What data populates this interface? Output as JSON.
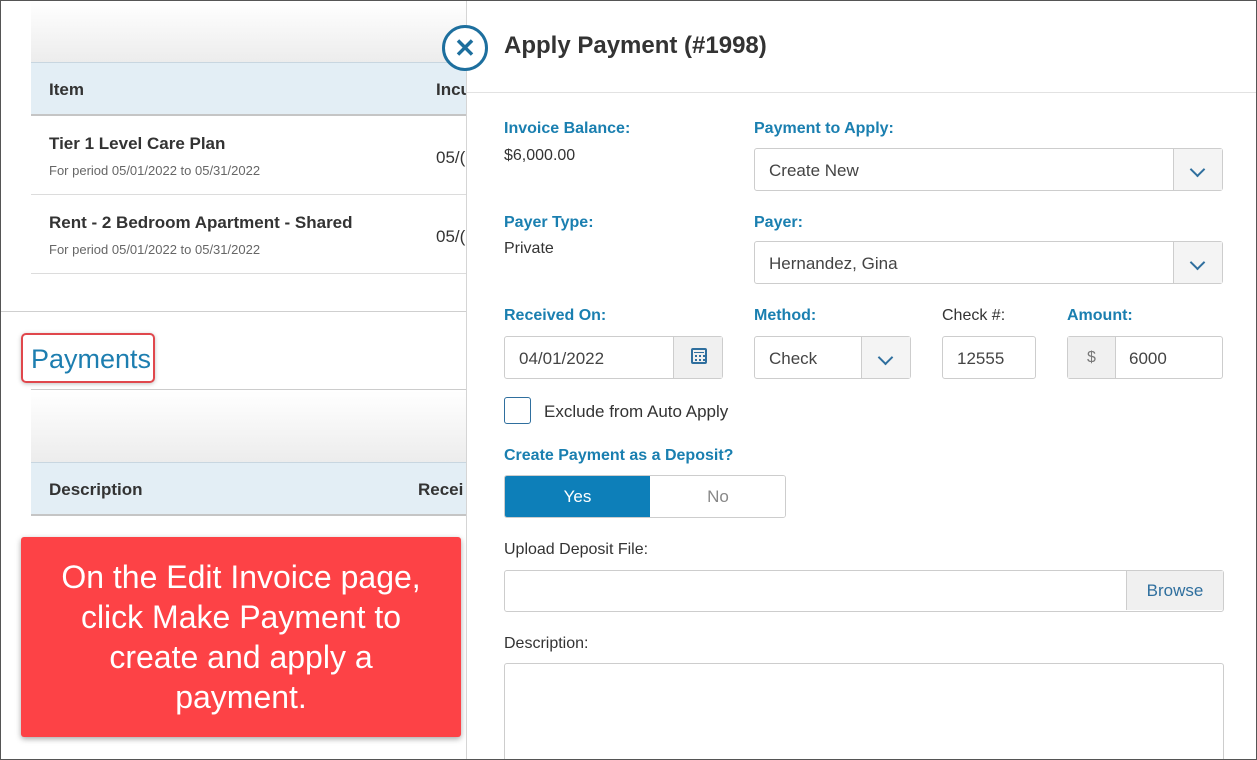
{
  "background": {
    "items_table": {
      "headers": [
        "Item",
        "Incu"
      ],
      "rows": [
        {
          "name": "Tier 1 Level Care Plan",
          "period": "For period 05/01/2022 to 05/31/2022",
          "date": "05/("
        },
        {
          "name": "Rent - 2 Bedroom Apartment - Shared",
          "period": "For period 05/01/2022 to 05/31/2022",
          "date": "05/("
        }
      ]
    },
    "payments_heading": "Payments",
    "payments_table": {
      "headers": [
        "Description",
        "Recei"
      ]
    }
  },
  "callout": {
    "text": "On the Edit Invoice page, click Make Payment to create and apply a payment."
  },
  "panel": {
    "title": "Apply Payment (#1998)",
    "invoice_balance": {
      "label": "Invoice Balance:",
      "value": "$6,000.00"
    },
    "payment_to_apply": {
      "label": "Payment to Apply:",
      "selected": "Create New"
    },
    "payer_type": {
      "label": "Payer Type:",
      "value": "Private"
    },
    "payer": {
      "label": "Payer:",
      "selected": "Hernandez, Gina"
    },
    "received_on": {
      "label": "Received On:",
      "value": "04/01/2022"
    },
    "method": {
      "label": "Method:",
      "selected": "Check"
    },
    "check_number": {
      "label": "Check #:",
      "value": "12555"
    },
    "amount": {
      "label": "Amount:",
      "prefix": "$",
      "value": "6000"
    },
    "exclude_auto_apply": {
      "label": "Exclude from Auto Apply",
      "checked": false
    },
    "deposit": {
      "label": "Create Payment as a Deposit?",
      "yes": "Yes",
      "no": "No",
      "selected": "Yes"
    },
    "upload": {
      "label": "Upload Deposit File:",
      "value": "",
      "browse": "Browse"
    },
    "description": {
      "label": "Description:",
      "value": ""
    }
  },
  "colors": {
    "accent": "#1a7fb0",
    "toggle_active": "#0d7fb9",
    "callout": "#fd4246",
    "highlight_border": "#e0474c"
  }
}
